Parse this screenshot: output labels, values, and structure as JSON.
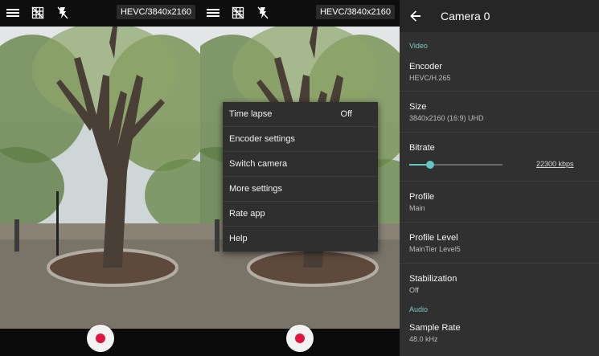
{
  "left": {
    "resolution": "HEVC/3840x2160",
    "icons": [
      "menu-icon",
      "grid-off-icon",
      "flash-off-icon"
    ]
  },
  "middle": {
    "resolution": "HEVC/3840x2160",
    "menu": {
      "items": [
        {
          "label": "Time lapse",
          "value": "Off"
        },
        {
          "label": "Encoder settings"
        },
        {
          "label": "Switch camera"
        },
        {
          "label": "More settings"
        },
        {
          "label": "Rate app"
        },
        {
          "label": "Help"
        }
      ]
    }
  },
  "settings": {
    "title": "Camera 0",
    "video_category": "Video",
    "encoder": {
      "title": "Encoder",
      "value": "HEVC/H.265"
    },
    "size": {
      "title": "Size",
      "value": "3840x2160 (16:9)  UHD"
    },
    "bitrate": {
      "title": "Bitrate",
      "value": "22300 kbps",
      "fraction": 0.22
    },
    "profile": {
      "title": "Profile",
      "value": "Main"
    },
    "profile_level": {
      "title": "Profile Level",
      "value": "MainTier Level5"
    },
    "stabilization": {
      "title": "Stabilization",
      "value": "Off"
    },
    "audio_category": "Audio",
    "sample_rate": {
      "title": "Sample Rate",
      "value": "48.0 kHz"
    }
  },
  "colors": {
    "accent": "#63c6c2",
    "record": "#e01440",
    "panel": "#303030"
  }
}
